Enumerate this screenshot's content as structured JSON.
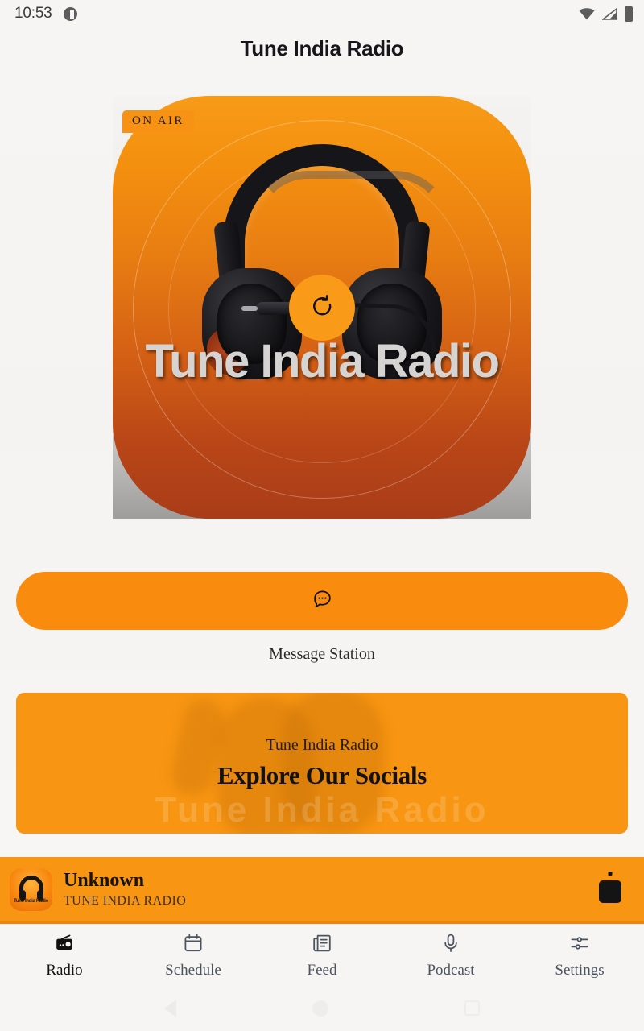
{
  "status_bar": {
    "time": "10:53",
    "dnd_icon": "do-not-disturb-icon",
    "wifi_icon": "wifi-icon",
    "signal_icon": "cellular-signal-icon",
    "battery_icon": "battery-full-icon"
  },
  "header": {
    "title": "Tune India Radio"
  },
  "player": {
    "on_air_badge": "ON AIR",
    "artwork_station_name": "Tune India Radio",
    "play_button_icon": "refresh-icon",
    "accent_color": "#F98B0E",
    "artwork_gradient_top": "#F79B18",
    "artwork_gradient_bottom": "#A93C18"
  },
  "message": {
    "button_icon": "chat-bubble-dots-icon",
    "label": "Message Station"
  },
  "socials": {
    "eyebrow": "Tune India Radio",
    "heading": "Explore Our Socials",
    "background_color": "#F89512",
    "ghost_text": "Tune India Radio"
  },
  "now_playing": {
    "thumbnail_icon": "station-logo-headphones",
    "thumbnail_text": "Tune India Radio",
    "title": "Unknown",
    "subtitle": "TUNE INDIA RADIO",
    "stop_button_icon": "stop-icon",
    "bar_color": "#F89512"
  },
  "tabs": [
    {
      "label": "Radio",
      "icon": "radio-icon",
      "active": true
    },
    {
      "label": "Schedule",
      "icon": "calendar-icon",
      "active": false
    },
    {
      "label": "Feed",
      "icon": "newspaper-icon",
      "active": false
    },
    {
      "label": "Podcast",
      "icon": "microphone-icon",
      "active": false
    },
    {
      "label": "Settings",
      "icon": "sliders-icon",
      "active": false
    }
  ],
  "android_nav": {
    "back_icon": "back-triangle-icon",
    "home_icon": "home-circle-icon",
    "recents_icon": "recents-square-icon"
  }
}
